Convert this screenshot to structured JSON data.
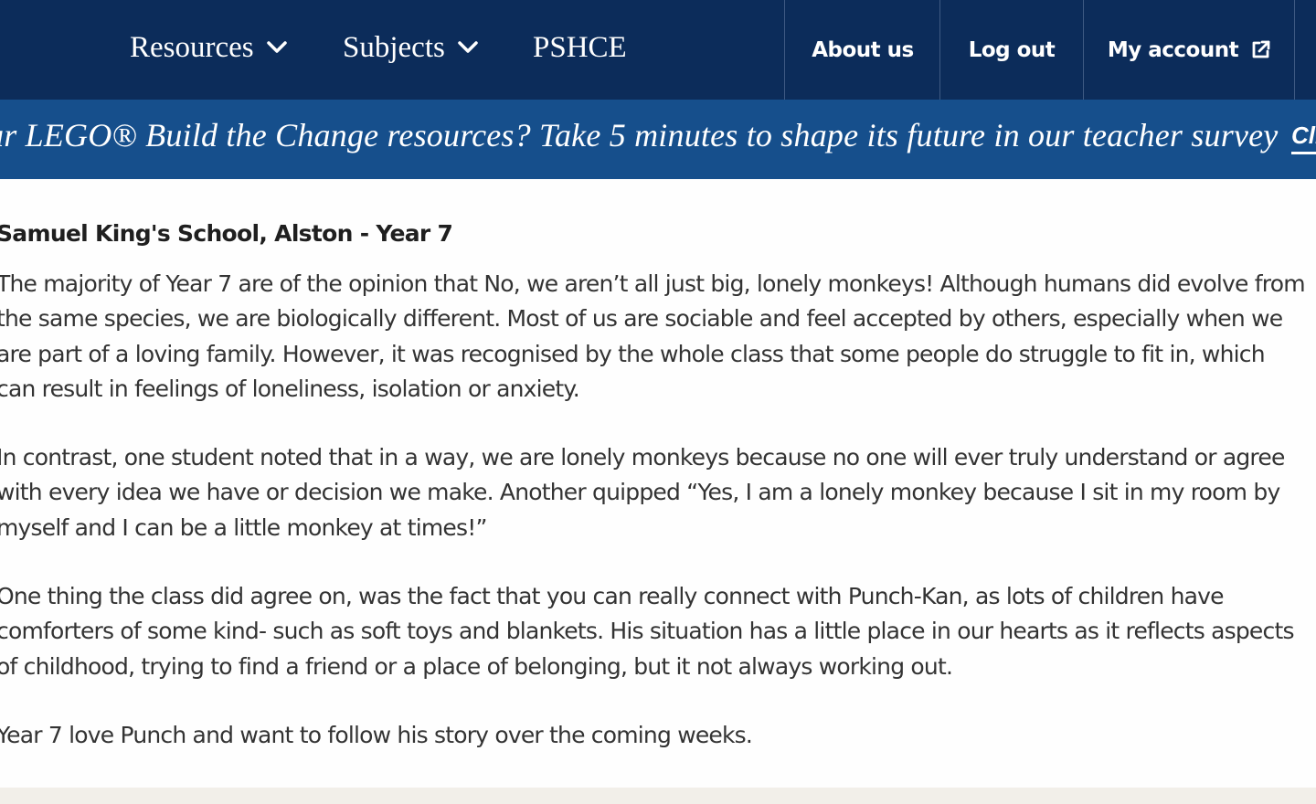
{
  "nav": {
    "resources": "Resources",
    "subjects": "Subjects",
    "pshce": "PSHCE",
    "about": "About us",
    "logout": "Log out",
    "account": "My account"
  },
  "banner": {
    "text": "ur LEGO® Build the Change resources? Take 5 minutes to shape its future in our teacher survey",
    "cta": "Cli"
  },
  "article": {
    "heading": "Samuel King's School, Alston - Year 7",
    "paragraphs": [
      "The majority of Year 7 are of the opinion that No, we aren’t all just big, lonely monkeys! Although humans did evolve from the same species, we are biologically different. Most of us are sociable and feel accepted by others, especially when we are part of a loving family. However, it was recognised by the whole class that some people do struggle to fit in, which can result in feelings of loneliness, isolation or anxiety.",
      "In contrast, one student noted that in a way, we are lonely monkeys because no one will ever truly understand or agree with every idea we have or decision we make. Another quipped “Yes, I am a lonely monkey because I sit in my room by myself and I can be a little monkey at times!”",
      "One thing the class did agree on, was the fact that you can really connect with Punch-Kan, as lots of children have comforters of some kind- such as soft toys and blankets. His situation has a little place in our hearts as it reflects aspects of childhood, trying to find a friend or a place of belonging, but it not always working out.",
      "Year 7 love Punch and want to follow his story over the coming weeks."
    ]
  },
  "colors": {
    "nav_bg": "#0c2c5a",
    "banner_bg": "#164f8c",
    "text": "#333333",
    "footer_bg": "#f2efe9"
  }
}
